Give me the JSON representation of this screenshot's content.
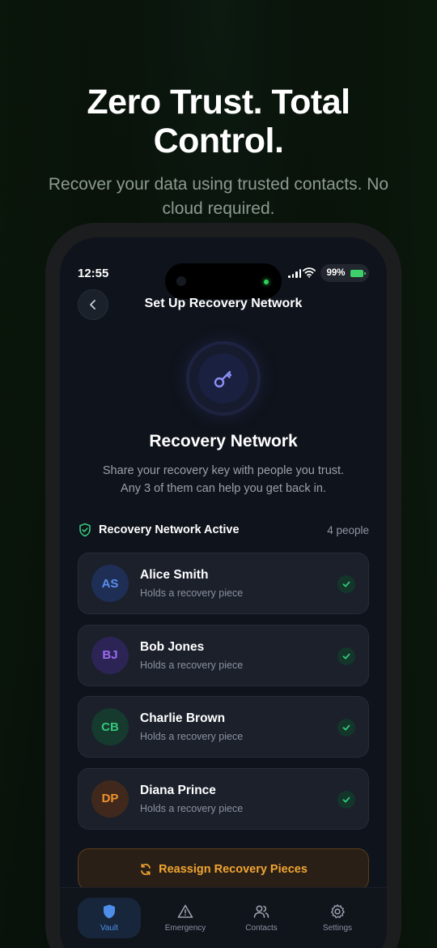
{
  "hero": {
    "title": "Zero Trust. Total Control.",
    "subtitle": "Recover your data using trusted contacts. No cloud required."
  },
  "status_bar": {
    "time": "12:55",
    "battery": "99%"
  },
  "nav": {
    "title": "Set Up Recovery Network",
    "back_icon": "chevron-left-icon"
  },
  "recovery": {
    "icon": "key-icon",
    "title": "Recovery Network",
    "description": "Share your recovery key with people you trust. Any 3 of them can help you get back in.",
    "status_label": "Recovery Network Active",
    "status_icon": "shield-check-icon",
    "count_label": "4 people"
  },
  "contacts": [
    {
      "initials": "AS",
      "name": "Alice Smith",
      "subtitle": "Holds a recovery piece",
      "color": "#5a8ff0",
      "bg": "#1f2e55"
    },
    {
      "initials": "BJ",
      "name": "Bob Jones",
      "subtitle": "Holds a recovery piece",
      "color": "#9a6cf0",
      "bg": "#2c2455"
    },
    {
      "initials": "CB",
      "name": "Charlie Brown",
      "subtitle": "Holds a recovery piece",
      "color": "#34c77b",
      "bg": "#163a2e"
    },
    {
      "initials": "DP",
      "name": "Diana Prince",
      "subtitle": "Holds a recovery piece",
      "color": "#f0932e",
      "bg": "#40291c"
    }
  ],
  "actions": {
    "reassign_label": "Reassign Recovery Pieces",
    "reassign_icon": "refresh-icon"
  },
  "tabs": [
    {
      "label": "Vault",
      "icon": "shield-icon",
      "active": true
    },
    {
      "label": "Emergency",
      "icon": "warning-icon",
      "active": false
    },
    {
      "label": "Contacts",
      "icon": "users-icon",
      "active": false
    },
    {
      "label": "Settings",
      "icon": "gear-icon",
      "active": false
    }
  ],
  "colors": {
    "accent_green": "#34c77b",
    "accent_blue": "#4d8fe8",
    "accent_orange": "#f0a531"
  }
}
